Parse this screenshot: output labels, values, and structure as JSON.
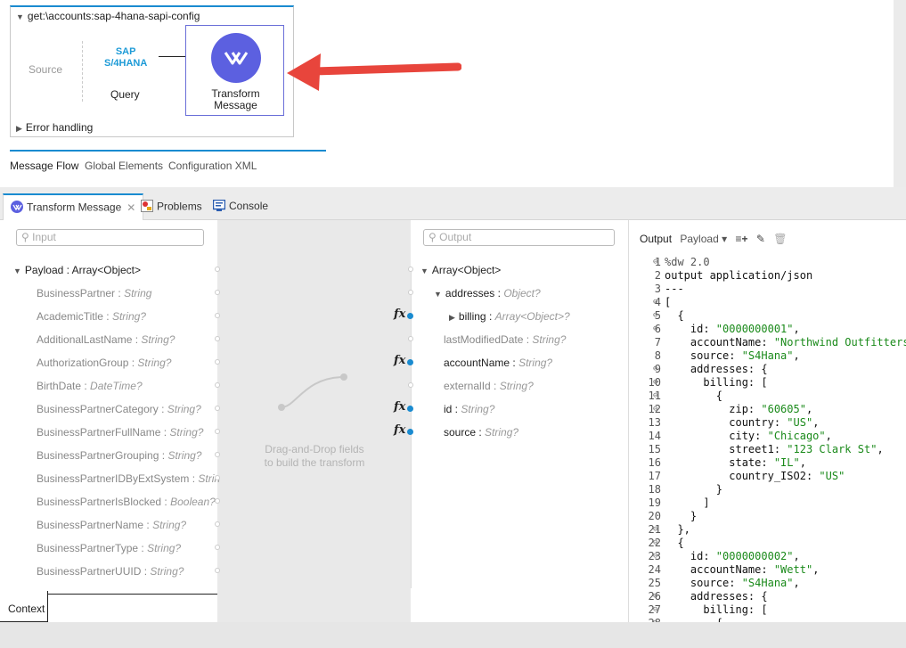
{
  "flow": {
    "title": "get:\\accounts:sap-4hana-sapi-config",
    "source": "Source",
    "sap_line1": "SAP",
    "sap_line2": "S/4HANA",
    "query": "Query",
    "transform_line1": "Transform",
    "transform_line2": "Message",
    "error_handling": "Error handling"
  },
  "editor_tabs": [
    "Message Flow",
    "Global Elements",
    "Configuration XML"
  ],
  "panel_tabs": {
    "transform": "Transform Message",
    "problems": "Problems",
    "console": "Console"
  },
  "input": {
    "placeholder": "Input",
    "root": "Payload : Array<Object>",
    "fields": [
      {
        "name": "BusinessPartner",
        "type": "String"
      },
      {
        "name": "AcademicTitle",
        "type": "String?"
      },
      {
        "name": "AdditionalLastName",
        "type": "String?"
      },
      {
        "name": "AuthorizationGroup",
        "type": "String?"
      },
      {
        "name": "BirthDate",
        "type": "DateTime?"
      },
      {
        "name": "BusinessPartnerCategory",
        "type": "String?"
      },
      {
        "name": "BusinessPartnerFullName",
        "type": "String?"
      },
      {
        "name": "BusinessPartnerGrouping",
        "type": "String?"
      },
      {
        "name": "BusinessPartnerIDByExtSystem",
        "type": "Strin"
      },
      {
        "name": "BusinessPartnerIsBlocked",
        "type": "Boolean?"
      },
      {
        "name": "BusinessPartnerName",
        "type": "String?"
      },
      {
        "name": "BusinessPartnerType",
        "type": "String?"
      },
      {
        "name": "BusinessPartnerUUID",
        "type": "String?"
      }
    ]
  },
  "drag_hint_1": "Drag-and-Drop fields",
  "drag_hint_2": "to build the transform",
  "context_tab": "Context",
  "output": {
    "placeholder": "Output",
    "root": "Array<Object>",
    "addresses": "addresses",
    "addresses_type": "Object?",
    "billing": "billing",
    "billing_type": "Array<Object>?",
    "fields": [
      {
        "name": "lastModifiedDate",
        "type": "String?"
      },
      {
        "name": "accountName",
        "type": "String?"
      },
      {
        "name": "externalId",
        "type": "String?"
      },
      {
        "name": "id",
        "type": "String?"
      },
      {
        "name": "source",
        "type": "String?"
      }
    ]
  },
  "output_header": {
    "label": "Output",
    "payload": "Payload"
  },
  "code": [
    "%dw 2.0",
    "output application/json",
    "---",
    "[",
    "  {",
    "    id: \"0000000001\",",
    "    accountName: \"Northwind Outfitters\",",
    "    source: \"S4Hana\",",
    "    addresses: {",
    "      billing: [",
    "        {",
    "          zip: \"60605\",",
    "          country: \"US\",",
    "          city: \"Chicago\",",
    "          street1: \"123 Clark St\",",
    "          state: \"IL\",",
    "          country_ISO2: \"US\"",
    "        }",
    "      ]",
    "    }",
    "  },",
    "  {",
    "    id: \"0000000002\",",
    "    accountName: \"Wett\",",
    "    source: \"S4Hana\",",
    "    addresses: {",
    "      billing: [",
    "        {"
  ],
  "colors": {
    "accent": "#1a8bd0",
    "transform": "#5c60e0",
    "arrow": "#e8453c"
  }
}
